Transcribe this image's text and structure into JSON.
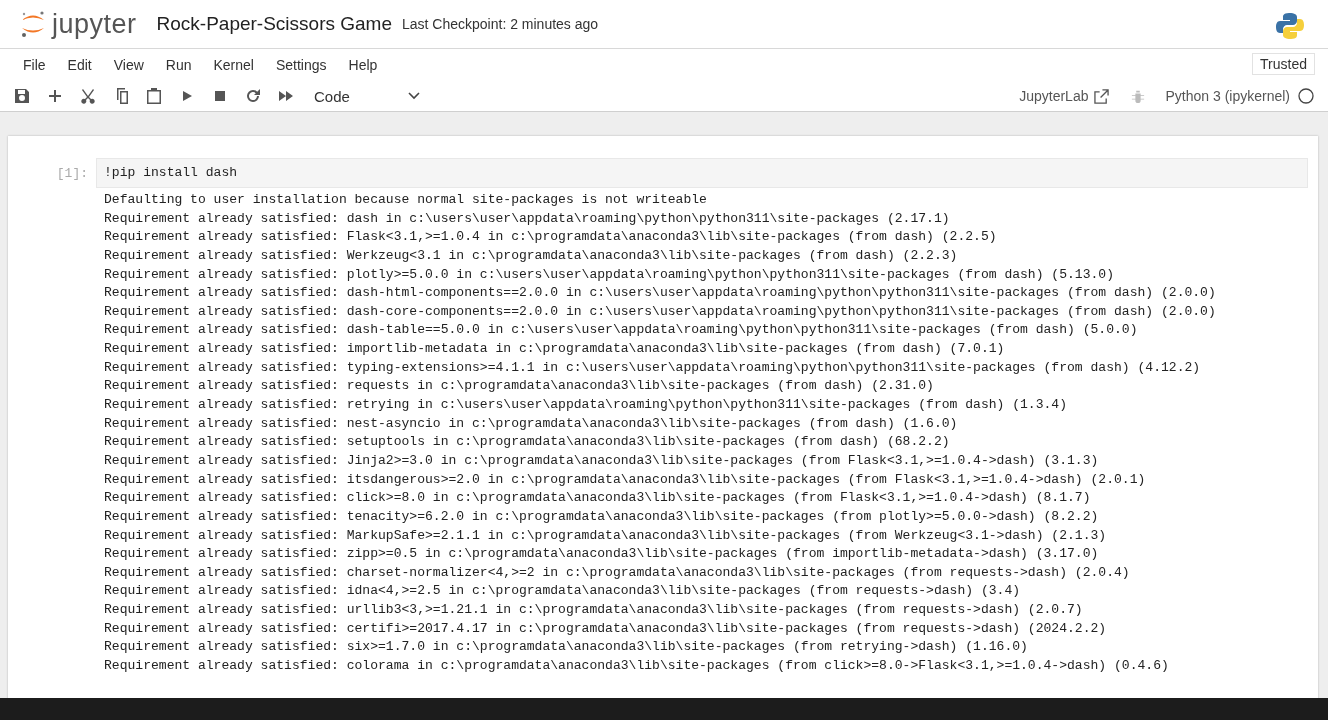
{
  "header": {
    "logo_text": "jupyter",
    "notebook_title": "Rock-Paper-Scissors Game",
    "checkpoint": "Last Checkpoint: 2 minutes ago"
  },
  "menu": [
    "File",
    "Edit",
    "View",
    "Run",
    "Kernel",
    "Settings",
    "Help"
  ],
  "trusted": "Trusted",
  "toolbar": {
    "cell_type": "Code",
    "jupyterlab_link": "JupyterLab",
    "kernel_name": "Python 3 (ipykernel)",
    "kernel_busy": false
  },
  "cells": [
    {
      "prompt": "[1]:",
      "source": "!pip install dash",
      "outputs": [
        "Defaulting to user installation because normal site-packages is not writeable",
        "Requirement already satisfied: dash in c:\\users\\user\\appdata\\roaming\\python\\python311\\site-packages (2.17.1)",
        "Requirement already satisfied: Flask<3.1,>=1.0.4 in c:\\programdata\\anaconda3\\lib\\site-packages (from dash) (2.2.5)",
        "Requirement already satisfied: Werkzeug<3.1 in c:\\programdata\\anaconda3\\lib\\site-packages (from dash) (2.2.3)",
        "Requirement already satisfied: plotly>=5.0.0 in c:\\users\\user\\appdata\\roaming\\python\\python311\\site-packages (from dash) (5.13.0)",
        "Requirement already satisfied: dash-html-components==2.0.0 in c:\\users\\user\\appdata\\roaming\\python\\python311\\site-packages (from dash) (2.0.0)",
        "Requirement already satisfied: dash-core-components==2.0.0 in c:\\users\\user\\appdata\\roaming\\python\\python311\\site-packages (from dash) (2.0.0)",
        "Requirement already satisfied: dash-table==5.0.0 in c:\\users\\user\\appdata\\roaming\\python\\python311\\site-packages (from dash) (5.0.0)",
        "Requirement already satisfied: importlib-metadata in c:\\programdata\\anaconda3\\lib\\site-packages (from dash) (7.0.1)",
        "Requirement already satisfied: typing-extensions>=4.1.1 in c:\\users\\user\\appdata\\roaming\\python\\python311\\site-packages (from dash) (4.12.2)",
        "Requirement already satisfied: requests in c:\\programdata\\anaconda3\\lib\\site-packages (from dash) (2.31.0)",
        "Requirement already satisfied: retrying in c:\\users\\user\\appdata\\roaming\\python\\python311\\site-packages (from dash) (1.3.4)",
        "Requirement already satisfied: nest-asyncio in c:\\programdata\\anaconda3\\lib\\site-packages (from dash) (1.6.0)",
        "Requirement already satisfied: setuptools in c:\\programdata\\anaconda3\\lib\\site-packages (from dash) (68.2.2)",
        "Requirement already satisfied: Jinja2>=3.0 in c:\\programdata\\anaconda3\\lib\\site-packages (from Flask<3.1,>=1.0.4->dash) (3.1.3)",
        "Requirement already satisfied: itsdangerous>=2.0 in c:\\programdata\\anaconda3\\lib\\site-packages (from Flask<3.1,>=1.0.4->dash) (2.0.1)",
        "Requirement already satisfied: click>=8.0 in c:\\programdata\\anaconda3\\lib\\site-packages (from Flask<3.1,>=1.0.4->dash) (8.1.7)",
        "Requirement already satisfied: tenacity>=6.2.0 in c:\\programdata\\anaconda3\\lib\\site-packages (from plotly>=5.0.0->dash) (8.2.2)",
        "Requirement already satisfied: MarkupSafe>=2.1.1 in c:\\programdata\\anaconda3\\lib\\site-packages (from Werkzeug<3.1->dash) (2.1.3)",
        "Requirement already satisfied: zipp>=0.5 in c:\\programdata\\anaconda3\\lib\\site-packages (from importlib-metadata->dash) (3.17.0)",
        "Requirement already satisfied: charset-normalizer<4,>=2 in c:\\programdata\\anaconda3\\lib\\site-packages (from requests->dash) (2.0.4)",
        "Requirement already satisfied: idna<4,>=2.5 in c:\\programdata\\anaconda3\\lib\\site-packages (from requests->dash) (3.4)",
        "Requirement already satisfied: urllib3<3,>=1.21.1 in c:\\programdata\\anaconda3\\lib\\site-packages (from requests->dash) (2.0.7)",
        "Requirement already satisfied: certifi>=2017.4.17 in c:\\programdata\\anaconda3\\lib\\site-packages (from requests->dash) (2024.2.2)",
        "Requirement already satisfied: six>=1.7.0 in c:\\programdata\\anaconda3\\lib\\site-packages (from retrying->dash) (1.16.0)",
        "Requirement already satisfied: colorama in c:\\programdata\\anaconda3\\lib\\site-packages (from click>=8.0->Flask<3.1,>=1.0.4->dash) (0.4.6)"
      ]
    }
  ]
}
